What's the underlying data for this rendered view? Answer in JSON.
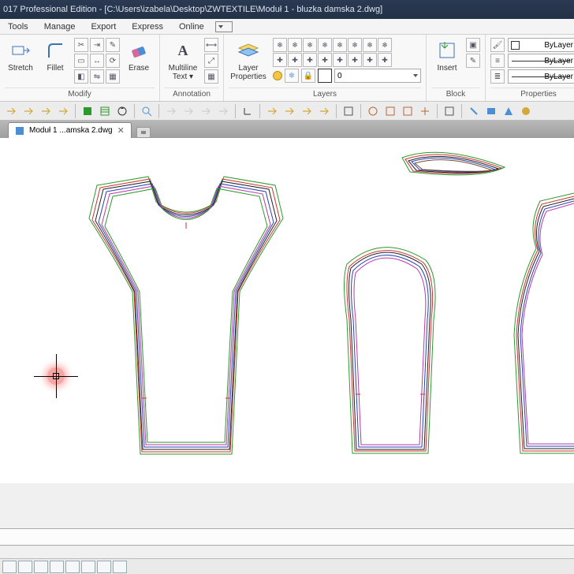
{
  "title": "017 Professional Edition - [C:\\Users\\izabela\\Desktop\\ZWTEXTILE\\Moduł 1 - bluzka damska 2.dwg]",
  "menu": {
    "tools": "Tools",
    "manage": "Manage",
    "export": "Export",
    "express": "Express",
    "online": "Online"
  },
  "ribbon": {
    "modify": {
      "title": "Modify",
      "stretch": "Stretch",
      "fillet": "Fillet",
      "erase": "Erase"
    },
    "annotation": {
      "title": "Annotation",
      "mtext": "Multiline\nText ▾"
    },
    "layers": {
      "title": "Layers",
      "lp": "Layer\nProperties",
      "current": "0"
    },
    "block": {
      "title": "Block",
      "insert": "Insert"
    },
    "properties": {
      "title": "Properties",
      "bylayer": "ByLayer"
    }
  },
  "doctab": {
    "label": "Moduł 1 ...amska 2.dwg"
  },
  "colors": {
    "red": "#c33",
    "green": "#2a9a2a",
    "blue": "#2a3fb5",
    "magenta": "#b53aa8",
    "black": "#222",
    "brown": "#7a4a2a"
  }
}
